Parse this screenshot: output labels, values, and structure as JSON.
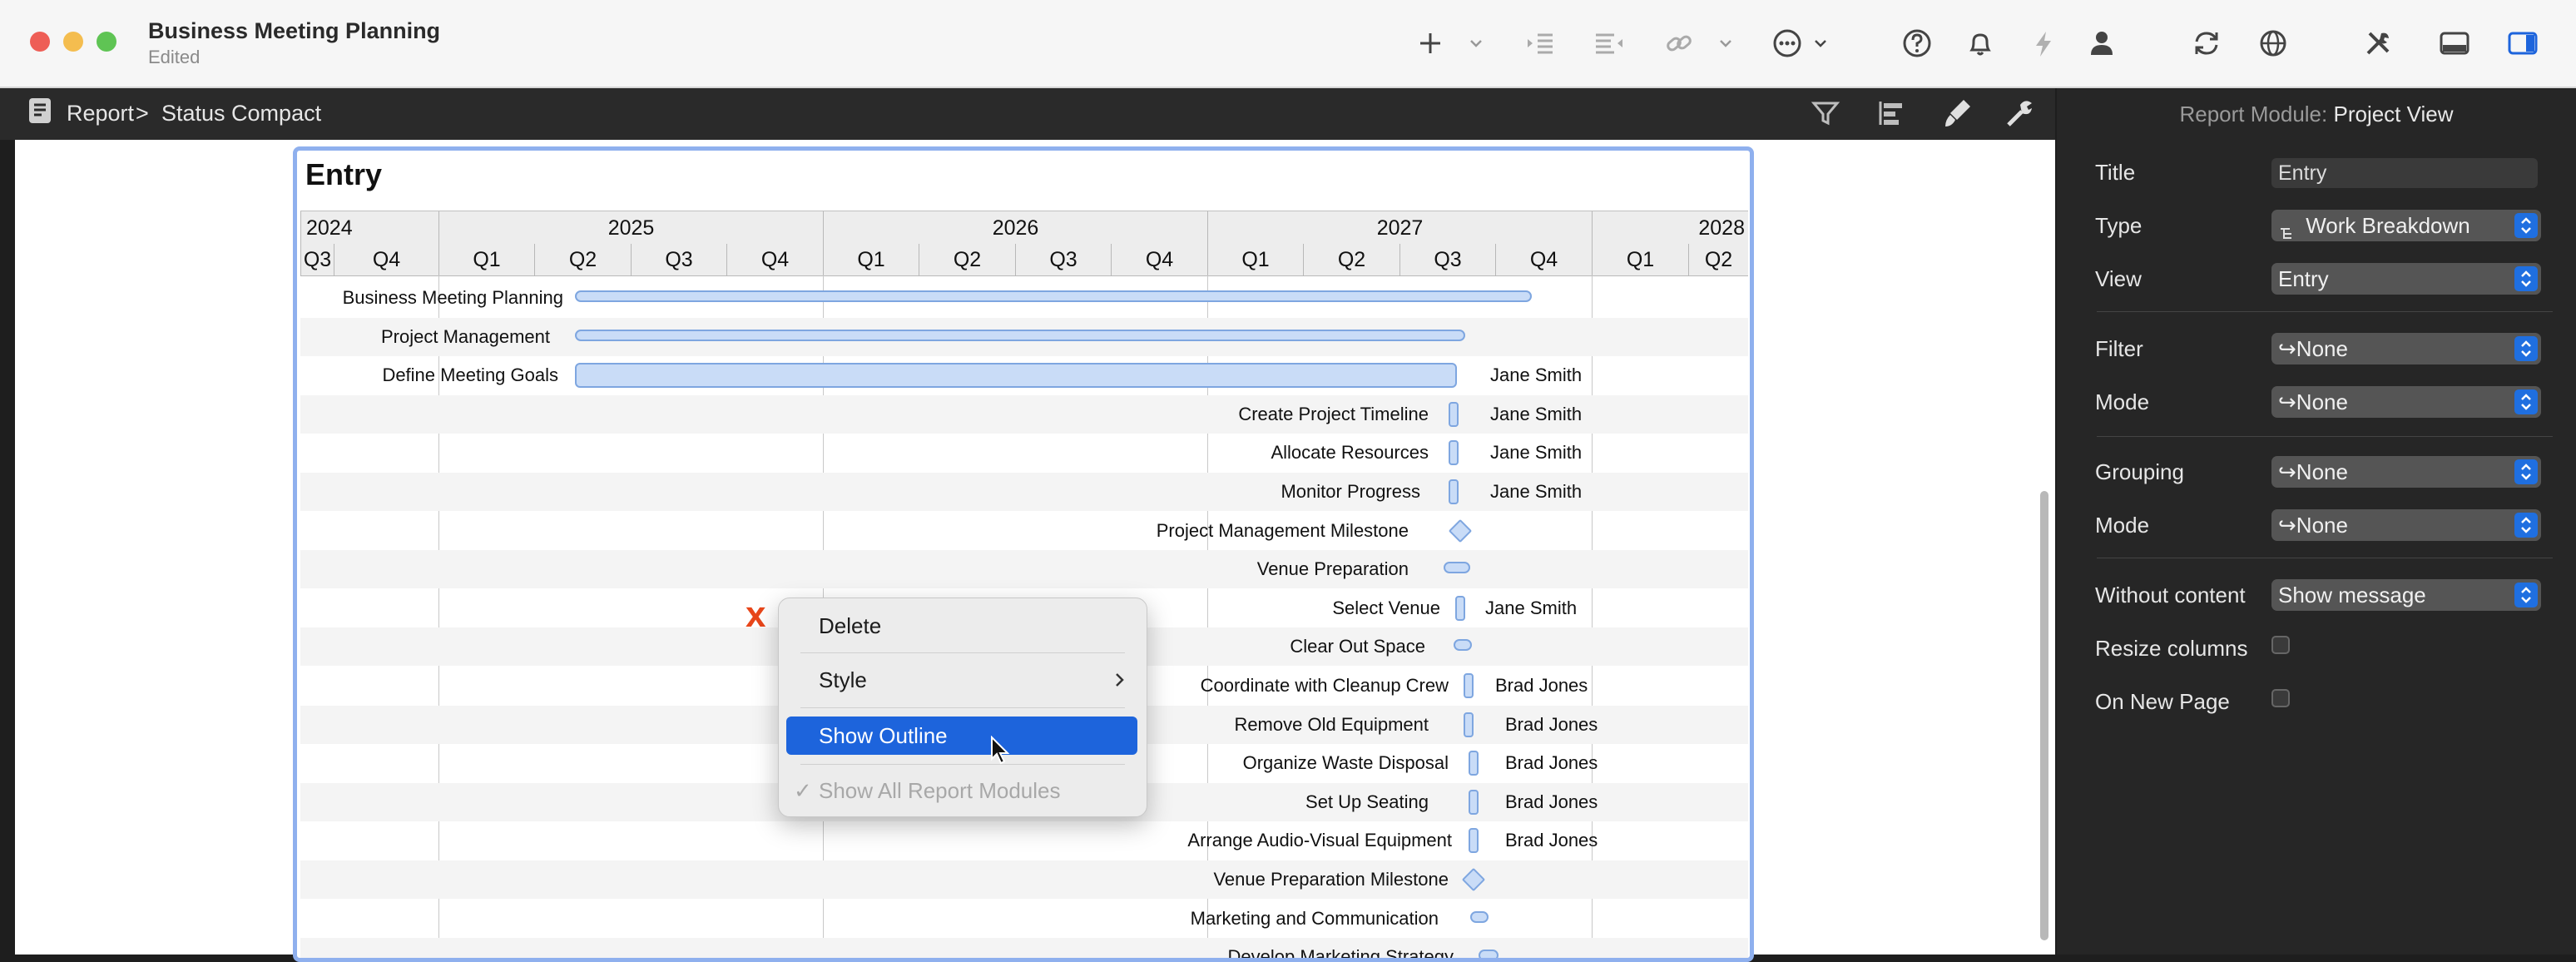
{
  "window": {
    "title": "Business Meeting Planning",
    "subtitle": "Edited"
  },
  "breadcrumb": {
    "root": "Report",
    "separator": ">",
    "current": "Status Compact"
  },
  "module": {
    "title": "Entry",
    "years": [
      "2024",
      "2025",
      "2026",
      "2027",
      "2028"
    ],
    "quarters": [
      "Q3",
      "Q4",
      "Q1",
      "Q2",
      "Q3",
      "Q4",
      "Q1",
      "Q2",
      "Q3",
      "Q4",
      "Q1",
      "Q2",
      "Q3",
      "Q4",
      "Q1",
      "Q2"
    ],
    "tasks": [
      {
        "name": "Business Meeting Planning",
        "resource": ""
      },
      {
        "name": "Project Management",
        "resource": ""
      },
      {
        "name": "Define Meeting Goals",
        "resource": "Jane Smith"
      },
      {
        "name": "Create Project Timeline",
        "resource": "Jane Smith"
      },
      {
        "name": "Allocate Resources",
        "resource": "Jane Smith"
      },
      {
        "name": "Monitor Progress",
        "resource": "Jane Smith"
      },
      {
        "name": "Project Management Milestone",
        "resource": ""
      },
      {
        "name": "Venue Preparation",
        "resource": ""
      },
      {
        "name": "Select Venue",
        "resource": "Jane Smith"
      },
      {
        "name": "Clear Out Space",
        "resource": ""
      },
      {
        "name": "Coordinate with Cleanup Crew",
        "resource": "Brad Jones"
      },
      {
        "name": "Remove Old Equipment",
        "resource": "Brad Jones"
      },
      {
        "name": "Organize Waste Disposal",
        "resource": "Brad Jones"
      },
      {
        "name": "Set Up Seating",
        "resource": "Brad Jones"
      },
      {
        "name": "Arrange Audio-Visual Equipment",
        "resource": "Brad Jones"
      },
      {
        "name": "Venue Preparation Milestone",
        "resource": ""
      },
      {
        "name": "Marketing and Communication",
        "resource": ""
      },
      {
        "name": "Develop Marketing Strategy",
        "resource": ""
      }
    ]
  },
  "context_menu": {
    "delete": "Delete",
    "style": "Style",
    "show_outline": "Show Outline",
    "show_all_check": "✓",
    "show_all": "Show All Report Modules"
  },
  "annotation": {
    "mark": "x"
  },
  "inspector": {
    "header_prefix": "Report Module:",
    "header_value": "Project View",
    "title_label": "Title",
    "title_value": "Entry",
    "type_label": "Type",
    "type_value": "Work Breakdown",
    "view_label": "View",
    "view_value": "Entry",
    "filter_label": "Filter",
    "filter_value": "None",
    "filter_mode_label": "Mode",
    "filter_mode_value": "None",
    "grouping_label": "Grouping",
    "grouping_value": "None",
    "grouping_mode_label": "Mode",
    "grouping_mode_value": "None",
    "without_content_label": "Without content",
    "without_content_value": "Show message",
    "resize_columns_label": "Resize columns",
    "resize_columns_checked": false,
    "new_page_label": "On New Page",
    "new_page_checked": false
  },
  "colors": {
    "accent": "#1d64dc",
    "bar_fill": "#c9dcf7",
    "bar_stroke": "#7ea6e0",
    "annotation": "#e8461a"
  }
}
